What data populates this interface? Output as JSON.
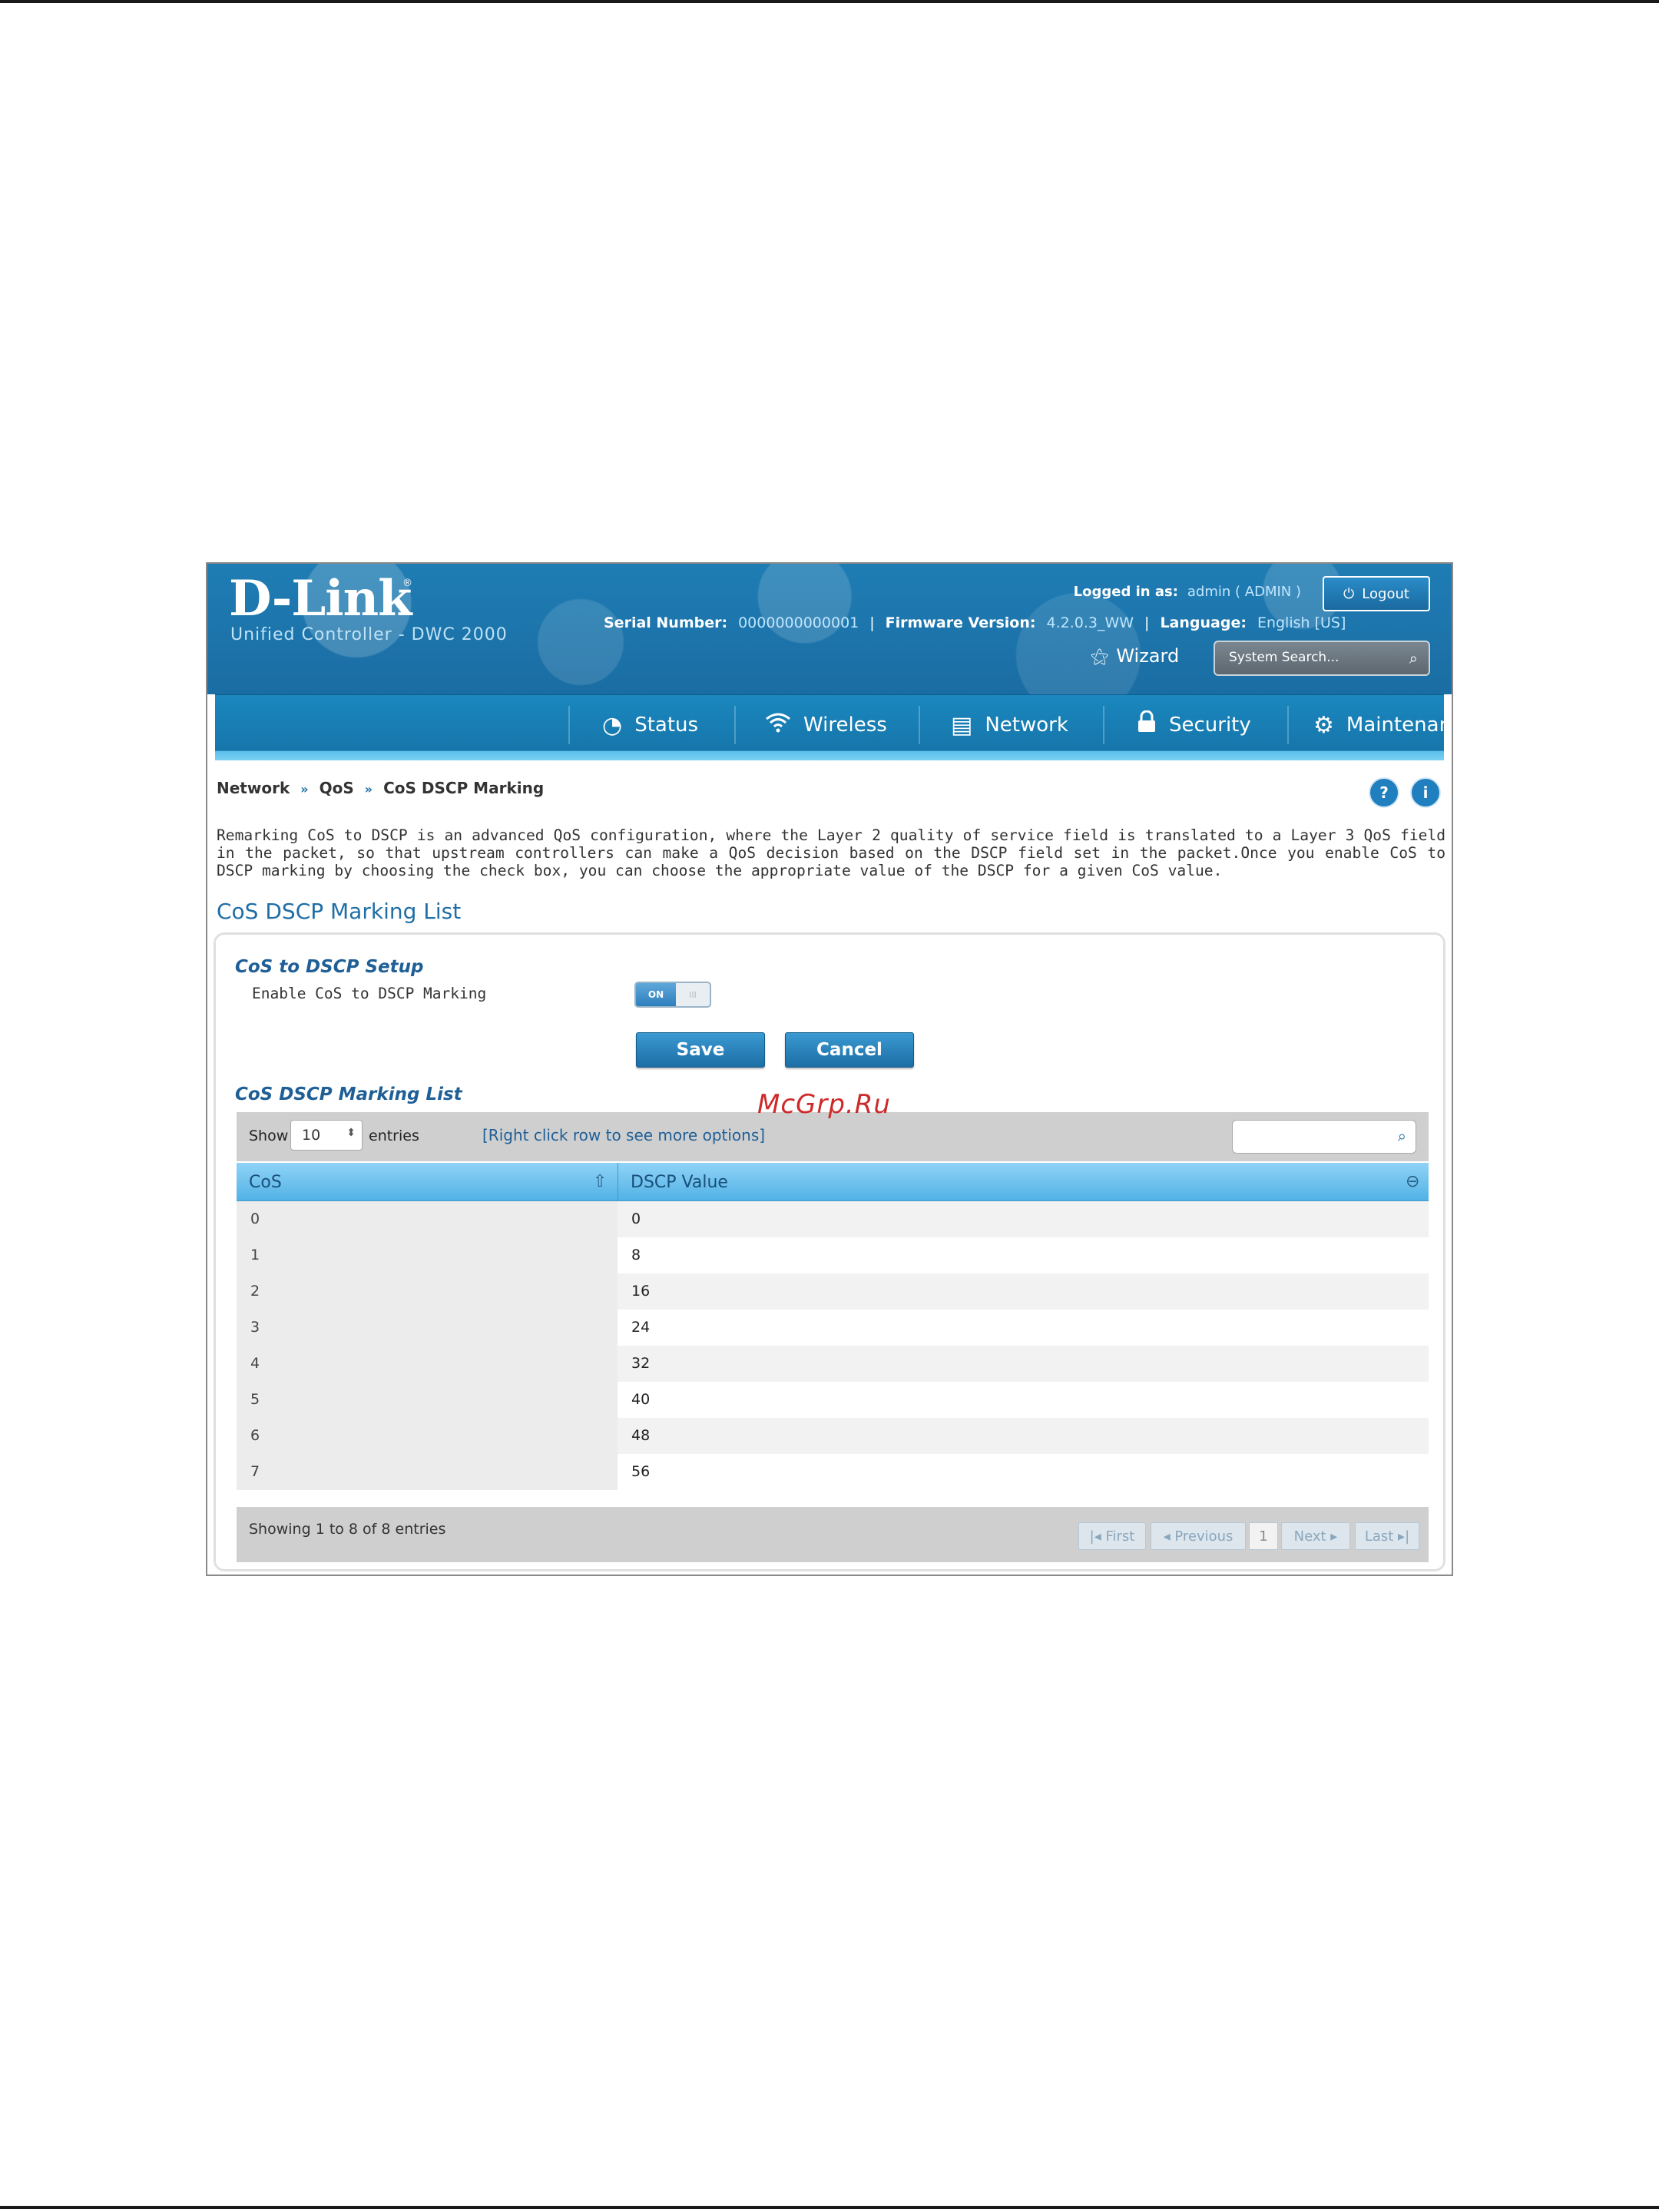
{
  "brand": {
    "logo": "D-Link",
    "registered": "®",
    "subtitle": "Unified Controller - DWC 2000"
  },
  "header": {
    "logged_in_label": "Logged in as:",
    "logged_in_value": "admin ( ADMIN )",
    "logout_label": "Logout",
    "serial_label": "Serial Number:",
    "serial_value": "0000000000001",
    "firmware_label": "Firmware Version:",
    "firmware_value": "4.2.0.3_WW",
    "language_label": "Language:",
    "language_value": "English [US]",
    "wizard_label": "Wizard",
    "search_placeholder": "System Search..."
  },
  "nav": {
    "items": [
      {
        "label": "Status",
        "icon": "gauge-icon"
      },
      {
        "label": "Wireless",
        "icon": "wifi-icon"
      },
      {
        "label": "Network",
        "icon": "network-icon"
      },
      {
        "label": "Security",
        "icon": "lock-icon"
      },
      {
        "label": "Maintenance",
        "icon": "gears-icon"
      }
    ]
  },
  "breadcrumb": {
    "items": [
      "Network",
      "QoS",
      "CoS DSCP Marking"
    ],
    "separator": "»"
  },
  "help": {
    "help_label": "?",
    "info_label": "i"
  },
  "description": "Remarking CoS to DSCP is an advanced QoS configuration, where the Layer 2 quality of service field is translated to a Layer 3 QoS field in the packet, so that upstream controllers can make a QoS decision based on the DSCP field set in the packet.Once you enable CoS to DSCP marking by choosing the check box, you can choose the appropriate value of the DSCP for a given CoS value.",
  "page_title": "CoS DSCP Marking List",
  "setup": {
    "title": "CoS to DSCP Setup",
    "enable_label": "Enable CoS to DSCP Marking",
    "toggle_on": "ON",
    "toggle_off": "III",
    "save_label": "Save",
    "cancel_label": "Cancel"
  },
  "list": {
    "title": "CoS DSCP Marking List",
    "show_label": "Show",
    "show_value": "10",
    "entries_label": "entries",
    "right_click_hint": "[Right click row to see more options]",
    "columns": [
      "CoS",
      "DSCP Value"
    ],
    "rows": [
      {
        "cos": "0",
        "dscp": "0"
      },
      {
        "cos": "1",
        "dscp": "8"
      },
      {
        "cos": "2",
        "dscp": "16"
      },
      {
        "cos": "3",
        "dscp": "24"
      },
      {
        "cos": "4",
        "dscp": "32"
      },
      {
        "cos": "5",
        "dscp": "40"
      },
      {
        "cos": "6",
        "dscp": "48"
      },
      {
        "cos": "7",
        "dscp": "56"
      }
    ],
    "showing_text": "Showing 1 to 8 of 8 entries",
    "pagination": {
      "first": "First",
      "previous": "Previous",
      "current": "1",
      "next": "Next",
      "last": "Last"
    }
  },
  "watermark": "McGrp.Ru",
  "colors": {
    "header_blue": "#1a6da3",
    "accent": "#1f6ea5",
    "table_head": "#52b2e6",
    "watermark_red": "#cf2a2a"
  }
}
